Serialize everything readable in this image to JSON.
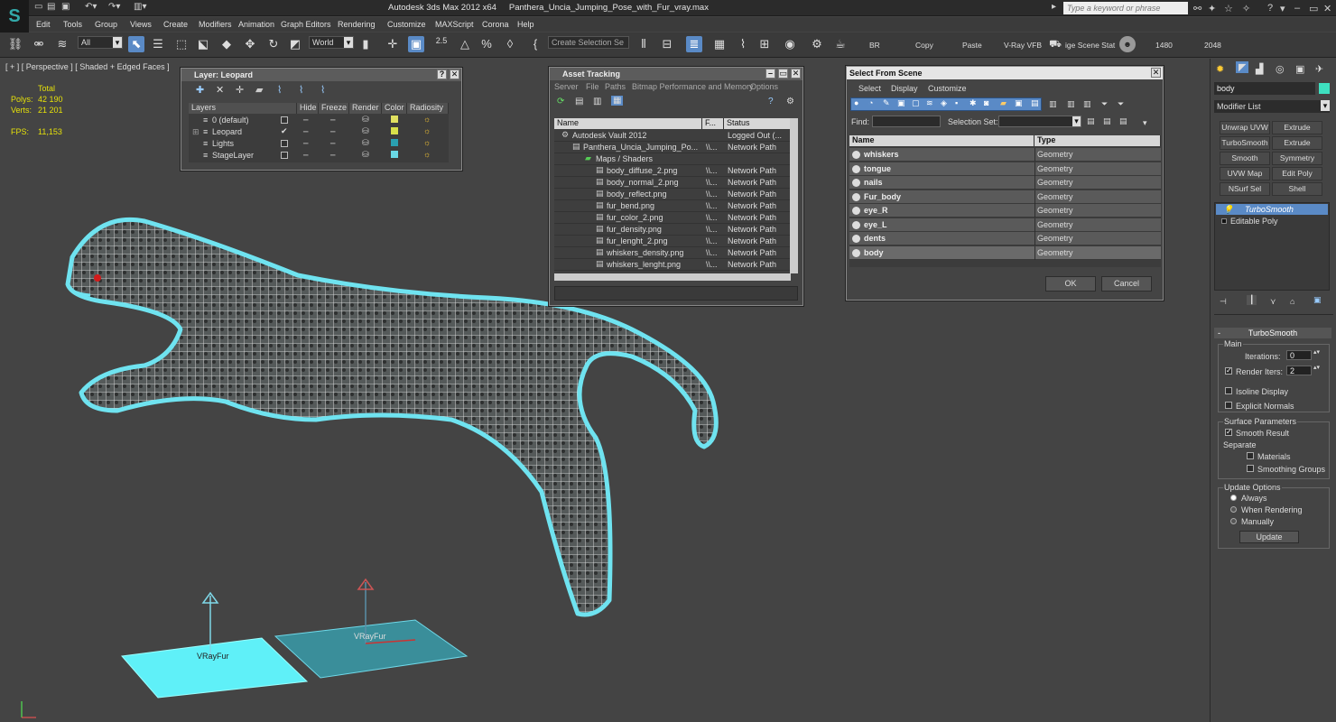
{
  "titlebar": {
    "app": "Autodesk 3ds Max  2012 x64",
    "file": "Panthera_Uncia_Jumping_Pose_with_Fur_vray.max",
    "search_placeholder": "Type a keyword or phrase"
  },
  "menu": [
    "Edit",
    "Tools",
    "Group",
    "Views",
    "Create",
    "Modifiers",
    "Animation",
    "Graph Editors",
    "Rendering",
    "Customize",
    "MAXScript",
    "Corona",
    "Help"
  ],
  "toolbar": {
    "filter": "All",
    "coord": "World",
    "snap_value": "2.5",
    "named_selection": "Create Selection Se",
    "labels": [
      "BR",
      "Copy",
      "Paste",
      "V-Ray VFB",
      "ige Scene Stat",
      "1480",
      "2048"
    ]
  },
  "viewport": {
    "label": "[ + ] [ Perspective ] [ Shaded + Edged Faces ]",
    "stats": {
      "total_label": "Total",
      "polys_label": "Polys:",
      "polys": "42 190",
      "verts_label": "Verts:",
      "verts": "21 201",
      "fps_label": "FPS:",
      "fps": "11,153"
    },
    "objects": [
      {
        "name": "VRayFur"
      },
      {
        "name": "VRayFur"
      }
    ]
  },
  "layer_window": {
    "title": "Layer: Leopard",
    "columns": [
      "Layers",
      "Hide",
      "Freeze",
      "Render",
      "Color",
      "Radiosity"
    ],
    "rows": [
      {
        "name": "0 (default)",
        "color": "#e0e060"
      },
      {
        "name": "Leopard",
        "color": "#d7e04a"
      },
      {
        "name": "Lights",
        "color": "#2aa0b0"
      },
      {
        "name": "StageLayer",
        "color": "#6ad9e6"
      }
    ]
  },
  "asset_window": {
    "title": "Asset Tracking",
    "menu": [
      "Server",
      "File",
      "Paths",
      "Bitmap Performance and Memory",
      "Options"
    ],
    "columns": [
      "Name",
      "F...",
      "Status"
    ],
    "rows": [
      {
        "name": "Autodesk Vault 2012",
        "f": "",
        "status": "Logged Out (..."
      },
      {
        "name": "Panthera_Uncia_Jumping_Po...",
        "f": "\\\\...",
        "status": "Network Path"
      },
      {
        "name": "Maps / Shaders",
        "f": "",
        "status": ""
      },
      {
        "name": "body_diffuse_2.png",
        "f": "\\\\...",
        "status": "Network Path"
      },
      {
        "name": "body_normal_2.png",
        "f": "\\\\...",
        "status": "Network Path"
      },
      {
        "name": "body_reflect.png",
        "f": "\\\\...",
        "status": "Network Path"
      },
      {
        "name": "fur_bend.png",
        "f": "\\\\...",
        "status": "Network Path"
      },
      {
        "name": "fur_color_2.png",
        "f": "\\\\...",
        "status": "Network Path"
      },
      {
        "name": "fur_density.png",
        "f": "\\\\...",
        "status": "Network Path"
      },
      {
        "name": "fur_lenght_2.png",
        "f": "\\\\...",
        "status": "Network Path"
      },
      {
        "name": "whiskers_density.png",
        "f": "\\\\...",
        "status": "Network Path"
      },
      {
        "name": "whiskers_lenght.png",
        "f": "\\\\...",
        "status": "Network Path"
      }
    ]
  },
  "scene_window": {
    "title": "Select From Scene",
    "menu": [
      "Select",
      "Display",
      "Customize"
    ],
    "find_label": "Find:",
    "selset_label": "Selection Set:",
    "columns": [
      "Name",
      "Type"
    ],
    "rows": [
      {
        "name": "whiskers",
        "type": "Geometry"
      },
      {
        "name": "tongue",
        "type": "Geometry"
      },
      {
        "name": "nails",
        "type": "Geometry"
      },
      {
        "name": "Fur_body",
        "type": "Geometry"
      },
      {
        "name": "eye_R",
        "type": "Geometry"
      },
      {
        "name": "eye_L",
        "type": "Geometry"
      },
      {
        "name": "dents",
        "type": "Geometry"
      },
      {
        "name": "body",
        "type": "Geometry"
      }
    ],
    "ok": "OK",
    "cancel": "Cancel"
  },
  "command_panel": {
    "object_name": "body",
    "object_color": "#3ee0c0",
    "modifier_list": "Modifier List",
    "buttons": [
      "Unwrap UVW",
      "Extrude",
      "TurboSmooth",
      "Extrude",
      "Smooth",
      "Symmetry",
      "UVW Map",
      "Edit Poly",
      "NSurf Sel",
      "Shell"
    ],
    "stack": [
      "TurboSmooth",
      "Editable Poly"
    ],
    "rollout_title": "TurboSmooth",
    "main_label": "Main",
    "iterations_label": "Iterations:",
    "iterations": "0",
    "render_iters_label": "Render Iters:",
    "render_iters": "2",
    "isoline": "Isoline Display",
    "explicit": "Explicit Normals",
    "surface_label": "Surface Parameters",
    "smooth_result": "Smooth Result",
    "separate": "Separate",
    "materials": "Materials",
    "smoothing_groups": "Smoothing Groups",
    "update_label": "Update Options",
    "always": "Always",
    "when_rendering": "When Rendering",
    "manually": "Manually",
    "update_btn": "Update"
  }
}
